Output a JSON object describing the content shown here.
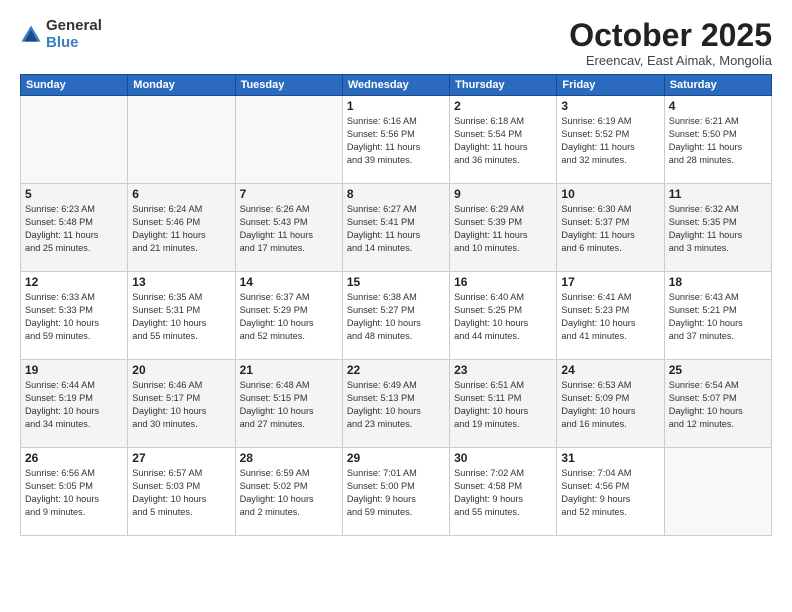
{
  "logo": {
    "general": "General",
    "blue": "Blue"
  },
  "header": {
    "title": "October 2025",
    "subtitle": "Ereencav, East Aimak, Mongolia"
  },
  "weekdays": [
    "Sunday",
    "Monday",
    "Tuesday",
    "Wednesday",
    "Thursday",
    "Friday",
    "Saturday"
  ],
  "weeks": [
    [
      {
        "day": "",
        "info": ""
      },
      {
        "day": "",
        "info": ""
      },
      {
        "day": "",
        "info": ""
      },
      {
        "day": "1",
        "info": "Sunrise: 6:16 AM\nSunset: 5:56 PM\nDaylight: 11 hours\nand 39 minutes."
      },
      {
        "day": "2",
        "info": "Sunrise: 6:18 AM\nSunset: 5:54 PM\nDaylight: 11 hours\nand 36 minutes."
      },
      {
        "day": "3",
        "info": "Sunrise: 6:19 AM\nSunset: 5:52 PM\nDaylight: 11 hours\nand 32 minutes."
      },
      {
        "day": "4",
        "info": "Sunrise: 6:21 AM\nSunset: 5:50 PM\nDaylight: 11 hours\nand 28 minutes."
      }
    ],
    [
      {
        "day": "5",
        "info": "Sunrise: 6:23 AM\nSunset: 5:48 PM\nDaylight: 11 hours\nand 25 minutes."
      },
      {
        "day": "6",
        "info": "Sunrise: 6:24 AM\nSunset: 5:46 PM\nDaylight: 11 hours\nand 21 minutes."
      },
      {
        "day": "7",
        "info": "Sunrise: 6:26 AM\nSunset: 5:43 PM\nDaylight: 11 hours\nand 17 minutes."
      },
      {
        "day": "8",
        "info": "Sunrise: 6:27 AM\nSunset: 5:41 PM\nDaylight: 11 hours\nand 14 minutes."
      },
      {
        "day": "9",
        "info": "Sunrise: 6:29 AM\nSunset: 5:39 PM\nDaylight: 11 hours\nand 10 minutes."
      },
      {
        "day": "10",
        "info": "Sunrise: 6:30 AM\nSunset: 5:37 PM\nDaylight: 11 hours\nand 6 minutes."
      },
      {
        "day": "11",
        "info": "Sunrise: 6:32 AM\nSunset: 5:35 PM\nDaylight: 11 hours\nand 3 minutes."
      }
    ],
    [
      {
        "day": "12",
        "info": "Sunrise: 6:33 AM\nSunset: 5:33 PM\nDaylight: 10 hours\nand 59 minutes."
      },
      {
        "day": "13",
        "info": "Sunrise: 6:35 AM\nSunset: 5:31 PM\nDaylight: 10 hours\nand 55 minutes."
      },
      {
        "day": "14",
        "info": "Sunrise: 6:37 AM\nSunset: 5:29 PM\nDaylight: 10 hours\nand 52 minutes."
      },
      {
        "day": "15",
        "info": "Sunrise: 6:38 AM\nSunset: 5:27 PM\nDaylight: 10 hours\nand 48 minutes."
      },
      {
        "day": "16",
        "info": "Sunrise: 6:40 AM\nSunset: 5:25 PM\nDaylight: 10 hours\nand 44 minutes."
      },
      {
        "day": "17",
        "info": "Sunrise: 6:41 AM\nSunset: 5:23 PM\nDaylight: 10 hours\nand 41 minutes."
      },
      {
        "day": "18",
        "info": "Sunrise: 6:43 AM\nSunset: 5:21 PM\nDaylight: 10 hours\nand 37 minutes."
      }
    ],
    [
      {
        "day": "19",
        "info": "Sunrise: 6:44 AM\nSunset: 5:19 PM\nDaylight: 10 hours\nand 34 minutes."
      },
      {
        "day": "20",
        "info": "Sunrise: 6:46 AM\nSunset: 5:17 PM\nDaylight: 10 hours\nand 30 minutes."
      },
      {
        "day": "21",
        "info": "Sunrise: 6:48 AM\nSunset: 5:15 PM\nDaylight: 10 hours\nand 27 minutes."
      },
      {
        "day": "22",
        "info": "Sunrise: 6:49 AM\nSunset: 5:13 PM\nDaylight: 10 hours\nand 23 minutes."
      },
      {
        "day": "23",
        "info": "Sunrise: 6:51 AM\nSunset: 5:11 PM\nDaylight: 10 hours\nand 19 minutes."
      },
      {
        "day": "24",
        "info": "Sunrise: 6:53 AM\nSunset: 5:09 PM\nDaylight: 10 hours\nand 16 minutes."
      },
      {
        "day": "25",
        "info": "Sunrise: 6:54 AM\nSunset: 5:07 PM\nDaylight: 10 hours\nand 12 minutes."
      }
    ],
    [
      {
        "day": "26",
        "info": "Sunrise: 6:56 AM\nSunset: 5:05 PM\nDaylight: 10 hours\nand 9 minutes."
      },
      {
        "day": "27",
        "info": "Sunrise: 6:57 AM\nSunset: 5:03 PM\nDaylight: 10 hours\nand 5 minutes."
      },
      {
        "day": "28",
        "info": "Sunrise: 6:59 AM\nSunset: 5:02 PM\nDaylight: 10 hours\nand 2 minutes."
      },
      {
        "day": "29",
        "info": "Sunrise: 7:01 AM\nSunset: 5:00 PM\nDaylight: 9 hours\nand 59 minutes."
      },
      {
        "day": "30",
        "info": "Sunrise: 7:02 AM\nSunset: 4:58 PM\nDaylight: 9 hours\nand 55 minutes."
      },
      {
        "day": "31",
        "info": "Sunrise: 7:04 AM\nSunset: 4:56 PM\nDaylight: 9 hours\nand 52 minutes."
      },
      {
        "day": "",
        "info": ""
      }
    ]
  ]
}
